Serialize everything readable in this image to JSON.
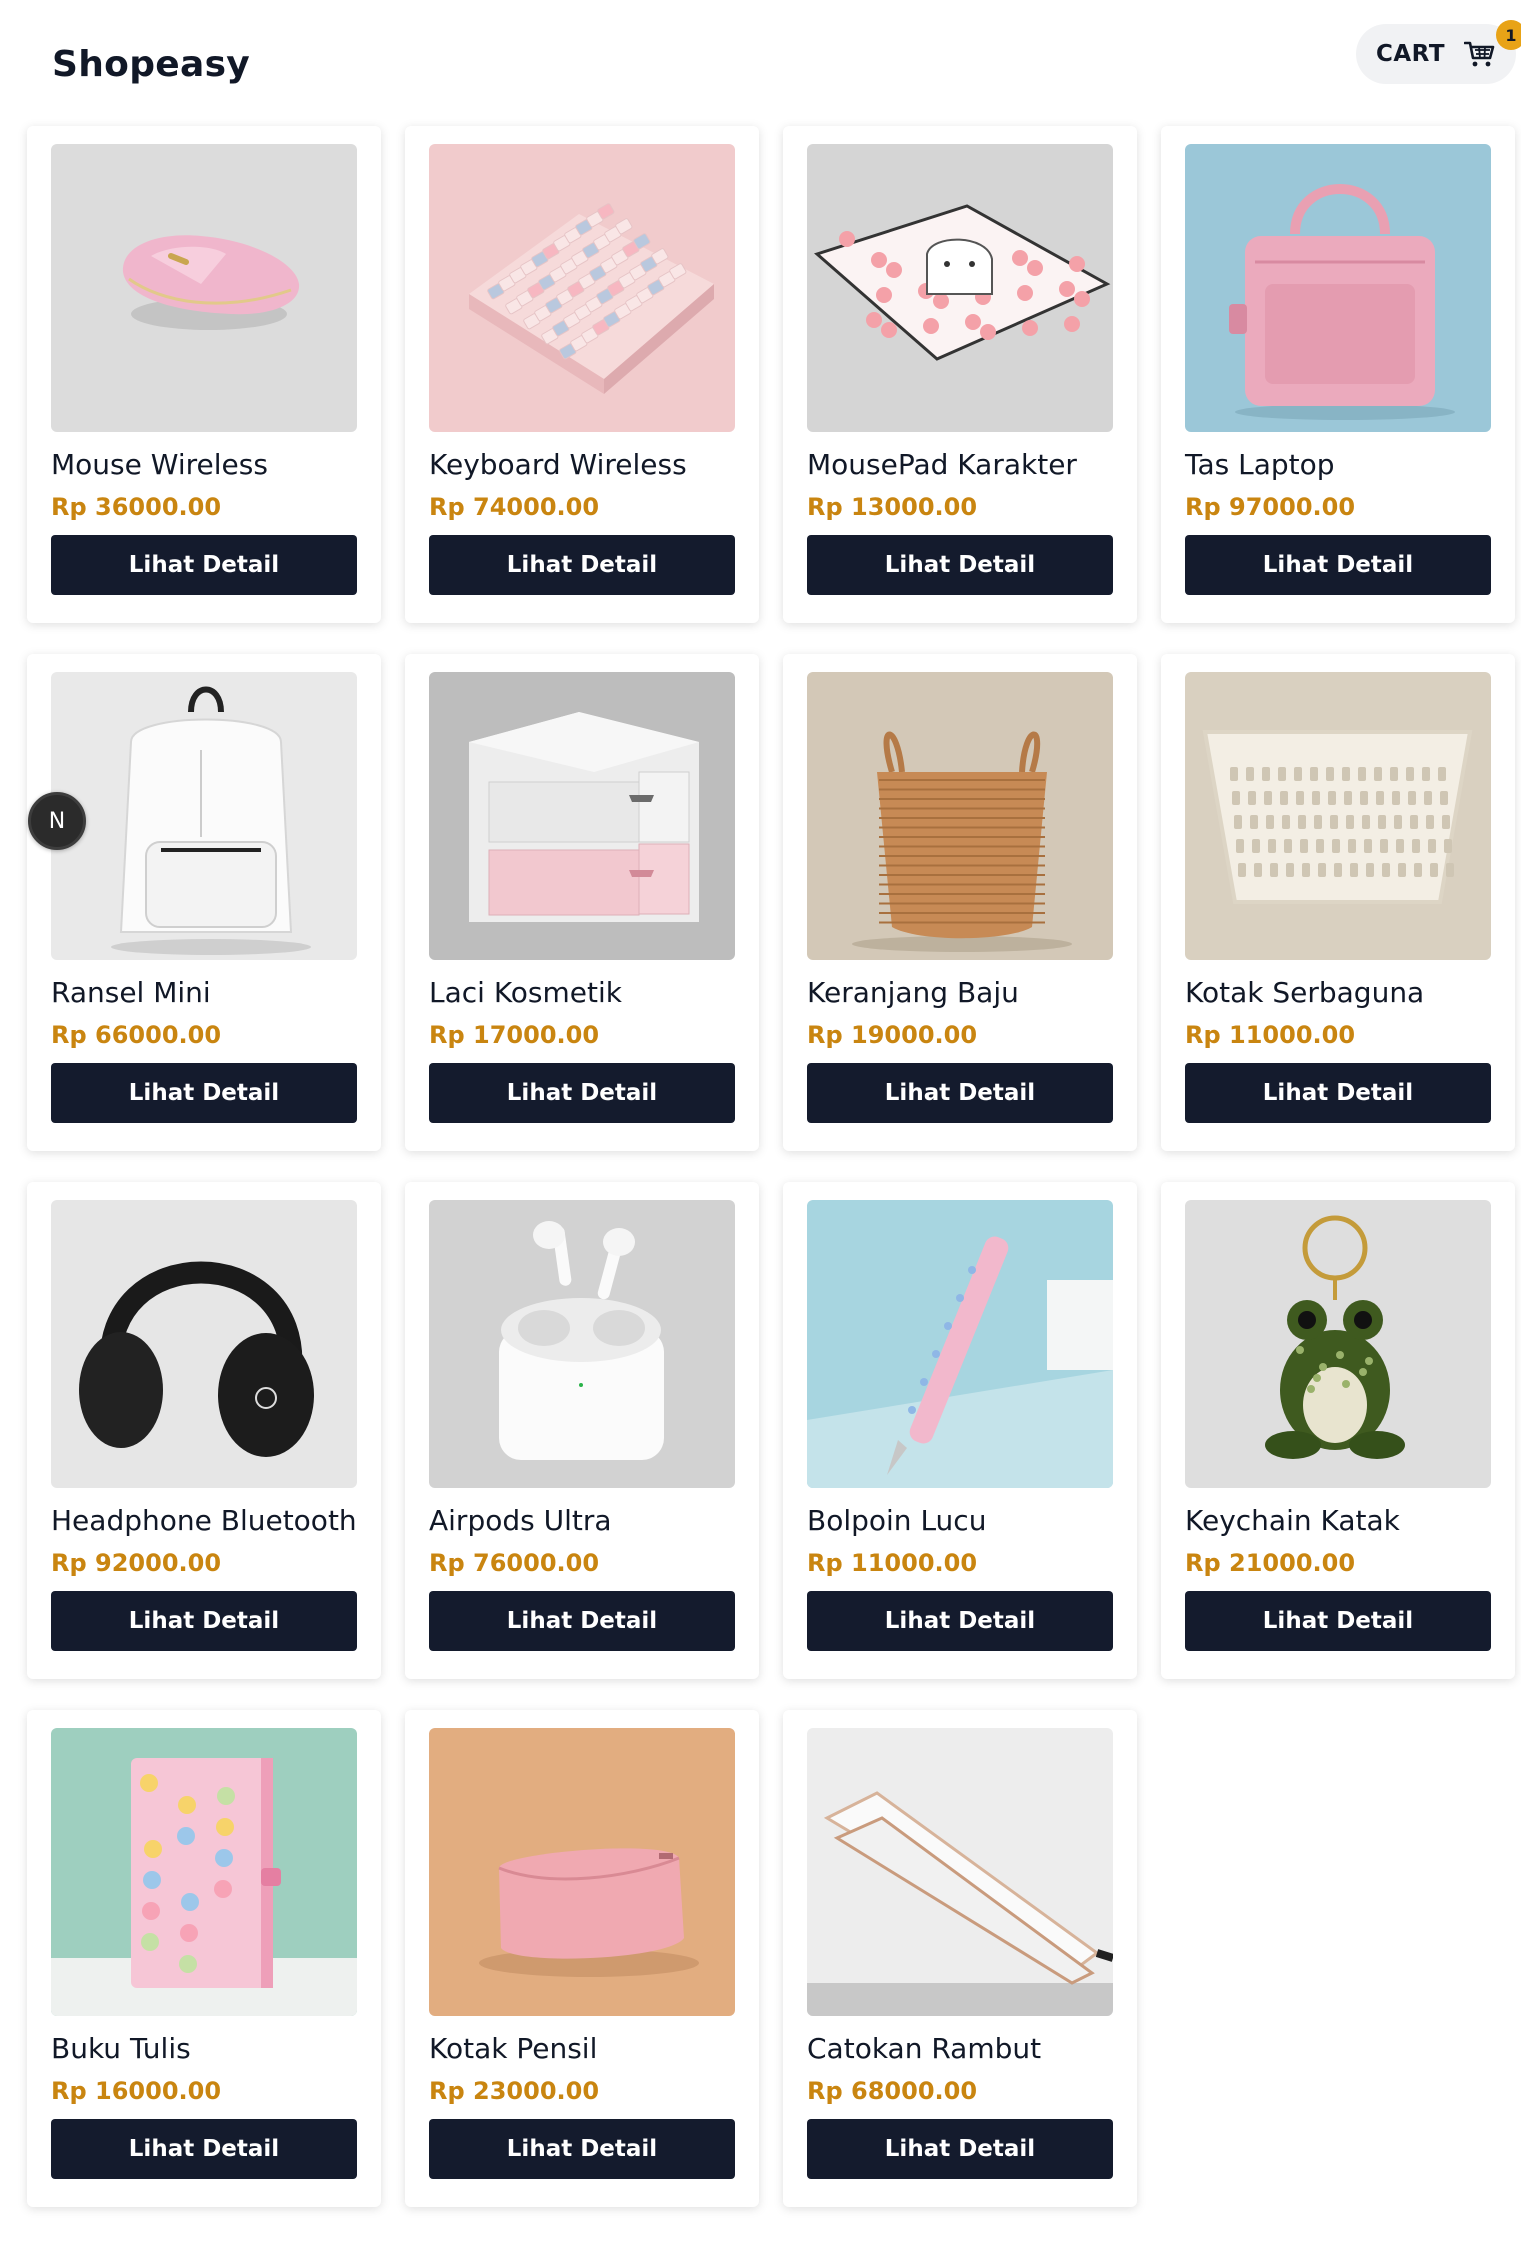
{
  "header": {
    "brand": "Shopeasy",
    "cart_label": "CART",
    "cart_count": "1",
    "cart_icon": "shopping-cart-icon"
  },
  "dev_badge": {
    "label": "N"
  },
  "products": [
    {
      "name": "Mouse Wireless",
      "price": "Rp 36000.00",
      "button": "Lihat Detail",
      "image": "pink-wireless-mouse"
    },
    {
      "name": "Keyboard Wireless",
      "price": "Rp 74000.00",
      "button": "Lihat Detail",
      "image": "pastel-keyboard"
    },
    {
      "name": "MousePad Karakter",
      "price": "Rp 13000.00",
      "button": "Lihat Detail",
      "image": "character-mousepad"
    },
    {
      "name": "Tas Laptop",
      "price": "Rp 97000.00",
      "button": "Lihat Detail",
      "image": "pink-laptop-bag"
    },
    {
      "name": "Ransel Mini",
      "price": "Rp 66000.00",
      "button": "Lihat Detail",
      "image": "white-backpack"
    },
    {
      "name": "Laci Kosmetik",
      "price": "Rp 17000.00",
      "button": "Lihat Detail",
      "image": "cosmetic-drawer"
    },
    {
      "name": "Keranjang Baju",
      "price": "Rp 19000.00",
      "button": "Lihat Detail",
      "image": "woven-basket"
    },
    {
      "name": "Kotak Serbaguna",
      "price": "Rp 11000.00",
      "button": "Lihat Detail",
      "image": "white-basket"
    },
    {
      "name": "Headphone Bluetooth",
      "price": "Rp 92000.00",
      "button": "Lihat Detail",
      "image": "black-headphones"
    },
    {
      "name": "Airpods Ultra",
      "price": "Rp 76000.00",
      "button": "Lihat Detail",
      "image": "airpods"
    },
    {
      "name": "Bolpoin Lucu",
      "price": "Rp 11000.00",
      "button": "Lihat Detail",
      "image": "pink-pen"
    },
    {
      "name": "Keychain Katak",
      "price": "Rp 21000.00",
      "button": "Lihat Detail",
      "image": "frog-keychain"
    },
    {
      "name": "Buku Tulis",
      "price": "Rp 16000.00",
      "button": "Lihat Detail",
      "image": "cat-notebook"
    },
    {
      "name": "Kotak Pensil",
      "price": "Rp 23000.00",
      "button": "Lihat Detail",
      "image": "pink-pencil-case"
    },
    {
      "name": "Catokan Rambut",
      "price": "Rp 68000.00",
      "button": "Lihat Detail",
      "image": "hair-straightener"
    }
  ]
}
